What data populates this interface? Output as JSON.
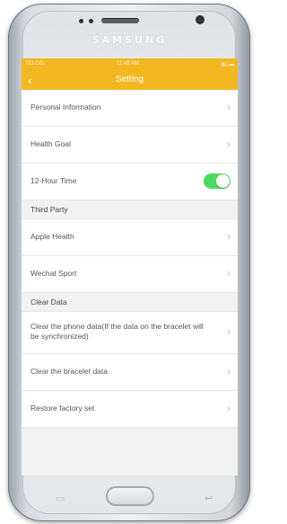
{
  "device": {
    "brand": "SAMSUNG"
  },
  "status_bar": {
    "carrier": "TELCEL",
    "time": "11:49 AM",
    "battery": "▮▯ ▬"
  },
  "nav": {
    "back_icon": "‹",
    "title": "Setting"
  },
  "rows": {
    "personal_information": "Personal Information",
    "health_goal": "Health Goal",
    "hour_time": "12-Hour Time",
    "apple_health": "Apple Health",
    "wechat_sport": "Wechat Sport",
    "clear_phone_data": "Clear the phone data(If the data on the bracelet will be synchronized)",
    "clear_bracelet_data": "Clear the bracelet data",
    "restore_factory": "Restore factory set"
  },
  "sections": {
    "third_party": "Third Party",
    "clear_data": "Clear Data"
  },
  "toggle_12_hour": {
    "on": true,
    "color": "#4cd964"
  },
  "chevron": "›",
  "colors": {
    "accent": "#f2b721",
    "background": "#f2f2f2"
  }
}
